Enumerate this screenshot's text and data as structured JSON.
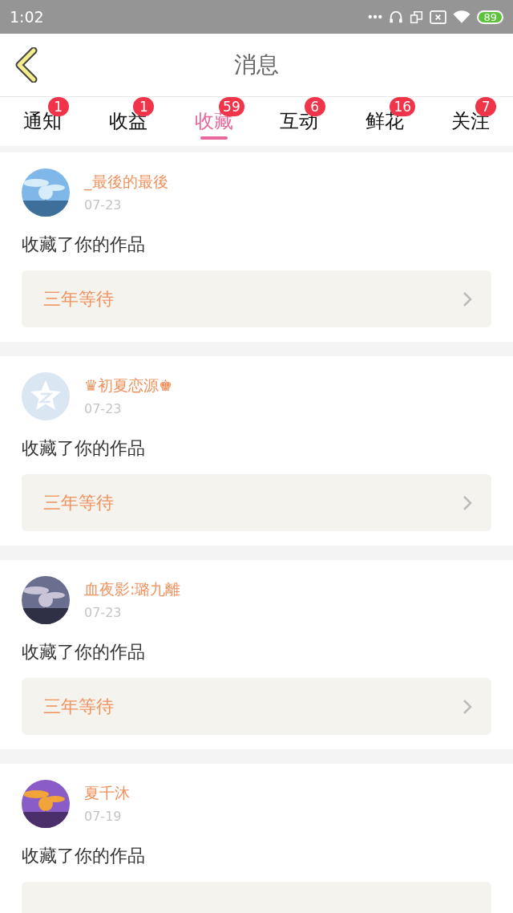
{
  "status_bar": {
    "time": "1:02",
    "battery": "89"
  },
  "header": {
    "title": "消息"
  },
  "tabs": [
    {
      "label": "通知",
      "badge": "1",
      "selected": false
    },
    {
      "label": "收益",
      "badge": "1",
      "selected": false
    },
    {
      "label": "收藏",
      "badge": "59",
      "selected": true
    },
    {
      "label": "互动",
      "badge": "6",
      "selected": false
    },
    {
      "label": "鲜花",
      "badge": "16",
      "selected": false
    },
    {
      "label": "关注",
      "badge": "7",
      "selected": false
    }
  ],
  "messages": [
    {
      "name": "_最後的最後",
      "date": "07-23",
      "text": "收藏了你的作品",
      "work": "三年等待"
    },
    {
      "avatar": {
        "kind": "default"
      },
      "name": "♛初夏恋源♚",
      "date": "07-23",
      "text": "收藏了你的作品",
      "work": "三年等待"
    },
    {
      "name": "血夜影:璐九離",
      "date": "07-23",
      "text": "收藏了你的作品",
      "work": "三年等待"
    },
    {
      "name": "夏千沐",
      "date": "07-19",
      "text": "收藏了你的作品"
    }
  ]
}
